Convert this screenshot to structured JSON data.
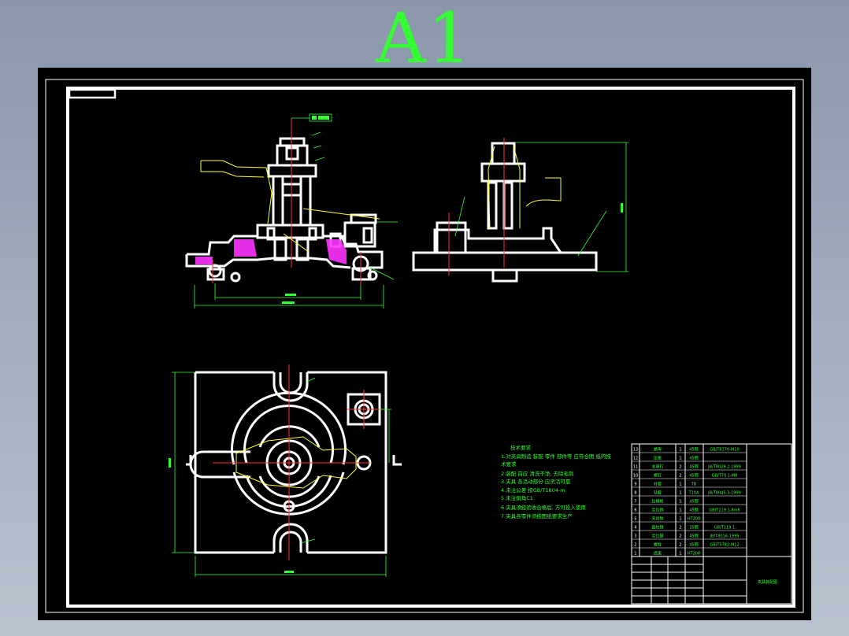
{
  "sheet": {
    "size_label": "A1"
  },
  "colors": {
    "outline": "#ffffff",
    "dimension": "#33ff33",
    "centerline": "#ff3333",
    "callout": "#ffff33",
    "background": "#000000",
    "frame": "#8a97aa"
  },
  "tech_notes": {
    "heading": "技术要求",
    "lines": [
      "1.对夹具制造 装配 零件 部件等 应符合图 纸的技",
      "术要求",
      "2.装配 前应 清洗干净, 去除毛刺",
      "3.夹具 各活动部分 应灵活可靠",
      "4.未注公差 按GB/T1804-m",
      "5.未注倒角C1",
      "6.夹具须经验收合格后, 方可投入使用",
      "7.夹具各零件须按图纸要求生产"
    ]
  },
  "title_block": {
    "drawing_name": "夹具装配图"
  },
  "parts_list": [
    {
      "no": "13",
      "name": "螺母",
      "qty": "1",
      "material": "45钢",
      "std": "GB/T6170-M10",
      "note": ""
    },
    {
      "no": "12",
      "name": "压板",
      "qty": "1",
      "material": "45钢",
      "std": "",
      "note": ""
    },
    {
      "no": "11",
      "name": "支承钉",
      "qty": "2",
      "material": "45钢",
      "std": "JB/T8029.2-1999",
      "note": ""
    },
    {
      "no": "10",
      "name": "螺钉",
      "qty": "2",
      "material": "45钢",
      "std": "GB/T70.1-M8",
      "note": ""
    },
    {
      "no": "9",
      "name": "衬套",
      "qty": "1",
      "material": "T8",
      "std": "",
      "note": ""
    },
    {
      "no": "8",
      "name": "钻套",
      "qty": "1",
      "material": "T10A",
      "std": "JB/T8045.3-1999",
      "note": ""
    },
    {
      "no": "7",
      "name": "钻模板",
      "qty": "1",
      "material": "45钢",
      "std": "",
      "note": ""
    },
    {
      "no": "6",
      "name": "定位销",
      "qty": "1",
      "material": "45钢",
      "std": "GB/T119.1-8m6",
      "note": ""
    },
    {
      "no": "5",
      "name": "夹具体",
      "qty": "1",
      "material": "HT200",
      "std": "",
      "note": ""
    },
    {
      "no": "4",
      "name": "圆柱销",
      "qty": "2",
      "material": "35钢",
      "std": "GB/T119.1",
      "note": ""
    },
    {
      "no": "3",
      "name": "定位键",
      "qty": "2",
      "material": "45钢",
      "std": "JB/T8016-1999",
      "note": ""
    },
    {
      "no": "2",
      "name": "螺栓",
      "qty": "2",
      "material": "45钢",
      "std": "GB/T5782-M12",
      "note": ""
    },
    {
      "no": "1",
      "name": "底座",
      "qty": "1",
      "material": "HT200",
      "std": "",
      "note": ""
    }
  ]
}
